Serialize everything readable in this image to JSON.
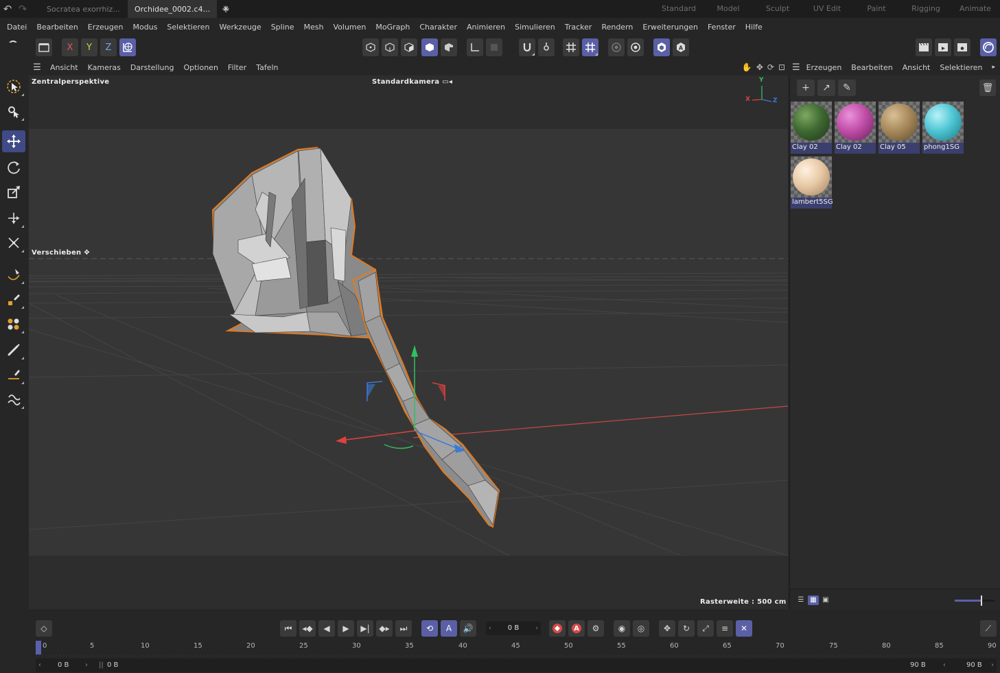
{
  "titlebar": {
    "undo_icon": "undo-icon",
    "redo_icon": "redo-icon",
    "tabs": [
      {
        "label": "Socratea exorrhiz...",
        "active": false
      },
      {
        "label": "Orchidee_0002.c4...",
        "active": true
      }
    ],
    "close_glyph": "✕",
    "add_glyph": "+",
    "layouts": [
      "Standard",
      "Model",
      "Sculpt",
      "UV Edit",
      "Paint",
      "Rigging",
      "Animate"
    ]
  },
  "menubar": [
    "Datei",
    "Bearbeiten",
    "Erzeugen",
    "Modus",
    "Selektieren",
    "Werkzeuge",
    "Spline",
    "Mesh",
    "Volumen",
    "MoGraph",
    "Charakter",
    "Animieren",
    "Simulieren",
    "Tracker",
    "Rendern",
    "Erweiterungen",
    "Fenster",
    "Hilfe"
  ],
  "toolbar": {
    "axis_x": "X",
    "axis_y": "Y",
    "axis_z": "Z"
  },
  "viewport": {
    "menu": [
      "Ansicht",
      "Kameras",
      "Darstellung",
      "Optionen",
      "Filter",
      "Tafeln"
    ],
    "projection_label": "Zentralperspektive",
    "camera_label": "Standardkamera",
    "tool_label": "Verschieben",
    "grid_label": "Rasterweite : 500 cm",
    "axis_labels": {
      "y": "Y",
      "x": "X",
      "z": "Z"
    },
    "colors": {
      "background": "#363636",
      "selection": "#e07a1f",
      "axis_x": "#e04040",
      "axis_y": "#30c060",
      "axis_z": "#3a7ad8"
    }
  },
  "materials_panel": {
    "menu": [
      "Erzeugen",
      "Bearbeiten",
      "Ansicht",
      "Selektieren"
    ],
    "materials": [
      {
        "name": "Clay 02",
        "color": "#3f6a32"
      },
      {
        "name": "Clay 02",
        "color": "#c04ea8"
      },
      {
        "name": "Clay 05",
        "color": "#a88a5c"
      },
      {
        "name": "phong1SG",
        "color": "#4fc6d4"
      },
      {
        "name": "lambert5SG",
        "color": "#e8c9a6"
      }
    ]
  },
  "timeline": {
    "current_frame": "0 B",
    "ruler_ticks": [
      "0",
      "5",
      "10",
      "15",
      "20",
      "25",
      "30",
      "35",
      "40",
      "45",
      "50",
      "55",
      "60",
      "65",
      "70",
      "75",
      "80",
      "85",
      "90"
    ],
    "range_start": "0 B",
    "range_start_inner": "0 B",
    "range_end_inner": "90 B",
    "range_end": "90 B",
    "record_label": "A"
  }
}
